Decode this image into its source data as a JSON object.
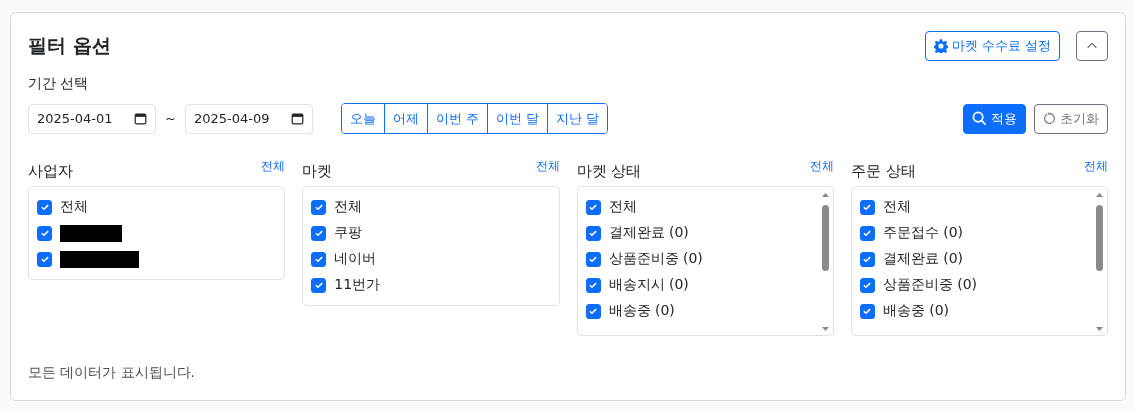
{
  "title": "필터 옵션",
  "header_buttons": {
    "settings": "마켓 수수료 설정",
    "collapse": {
      "expanded": true
    }
  },
  "period": {
    "label": "기간 선택",
    "start": "2025-04-01",
    "separator": "~",
    "end": "2025-04-09",
    "quick": [
      "오늘",
      "어제",
      "이번 주",
      "이번 달",
      "지난 달"
    ]
  },
  "actions": {
    "apply": "적용",
    "reset": "초기화"
  },
  "groups": [
    {
      "title": "사업자",
      "select_all": "전체",
      "scroll": false,
      "items": [
        {
          "kind": "text",
          "label": "전체",
          "checked": true
        },
        {
          "kind": "redacted",
          "checked": true
        },
        {
          "kind": "redacted",
          "checked": true
        }
      ]
    },
    {
      "title": "마켓",
      "select_all": "전체",
      "scroll": false,
      "items": [
        {
          "kind": "text",
          "label": "전체",
          "checked": true
        },
        {
          "kind": "text",
          "label": "쿠팡",
          "checked": true
        },
        {
          "kind": "text",
          "label": "네이버",
          "checked": true
        },
        {
          "kind": "text",
          "label": "11번가",
          "checked": true
        }
      ]
    },
    {
      "title": "마켓 상태",
      "select_all": "전체",
      "scroll": true,
      "items": [
        {
          "kind": "text",
          "label": "전체",
          "checked": true
        },
        {
          "kind": "text",
          "label": "결제완료 (0)",
          "checked": true
        },
        {
          "kind": "text",
          "label": "상품준비중 (0)",
          "checked": true
        },
        {
          "kind": "text",
          "label": "배송지시 (0)",
          "checked": true
        },
        {
          "kind": "text",
          "label": "배송중 (0)",
          "checked": true
        }
      ]
    },
    {
      "title": "주문 상태",
      "select_all": "전체",
      "scroll": true,
      "items": [
        {
          "kind": "text",
          "label": "전체",
          "checked": true
        },
        {
          "kind": "text",
          "label": "주문접수 (0)",
          "checked": true
        },
        {
          "kind": "text",
          "label": "결제완료 (0)",
          "checked": true
        },
        {
          "kind": "text",
          "label": "상품준비중 (0)",
          "checked": true
        },
        {
          "kind": "text",
          "label": "배송중 (0)",
          "checked": true
        }
      ]
    }
  ],
  "footer": "모든 데이터가 표시됩니다."
}
